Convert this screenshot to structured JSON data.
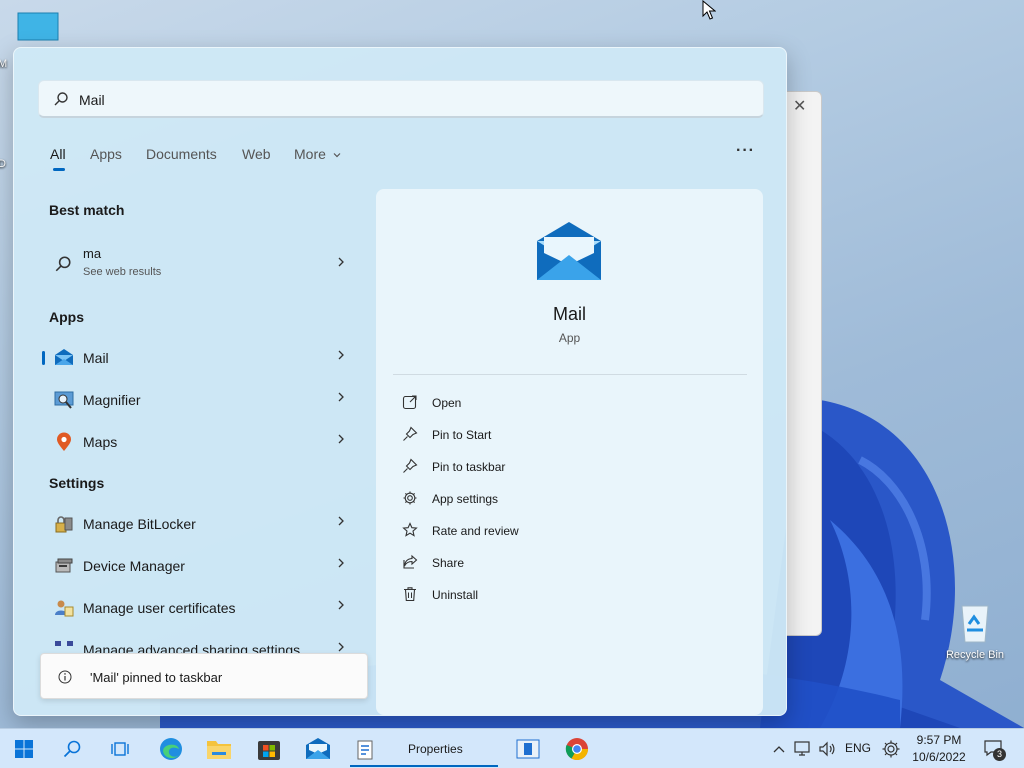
{
  "desktop": {
    "icons": [
      {
        "label": "M"
      },
      {
        "label": "D"
      },
      {
        "label": "Recycle Bin"
      }
    ]
  },
  "search": {
    "value": "Mail"
  },
  "tabs": [
    {
      "label": "All",
      "active": true
    },
    {
      "label": "Apps"
    },
    {
      "label": "Documents"
    },
    {
      "label": "Web"
    },
    {
      "label": "More"
    }
  ],
  "best_match": {
    "title": "Best match",
    "item": {
      "name": "ma",
      "sub": "See web results"
    }
  },
  "apps": {
    "title": "Apps",
    "items": [
      {
        "name": "Mail",
        "selected": true
      },
      {
        "name": "Magnifier"
      },
      {
        "name": "Maps"
      }
    ]
  },
  "settings": {
    "title": "Settings",
    "items": [
      {
        "name": "Manage BitLocker"
      },
      {
        "name": "Device Manager"
      },
      {
        "name": "Manage user certificates"
      },
      {
        "name": "Manage advanced sharing settings"
      }
    ]
  },
  "details": {
    "title": "Mail",
    "kind": "App",
    "actions": [
      {
        "label": "Open",
        "icon": "open-icon"
      },
      {
        "label": "Pin to Start",
        "icon": "pin-icon"
      },
      {
        "label": "Pin to taskbar",
        "icon": "pin-icon"
      },
      {
        "label": "App settings",
        "icon": "gear-icon"
      },
      {
        "label": "Rate and review",
        "icon": "star-icon"
      },
      {
        "label": "Share",
        "icon": "share-icon"
      },
      {
        "label": "Uninstall",
        "icon": "trash-icon"
      }
    ]
  },
  "toast": {
    "message": "'Mail' pinned to taskbar"
  },
  "taskbar": {
    "running_app": "Properties",
    "language": "ENG",
    "time": "9:57 PM",
    "date": "10/6/2022",
    "notifications": "3"
  }
}
